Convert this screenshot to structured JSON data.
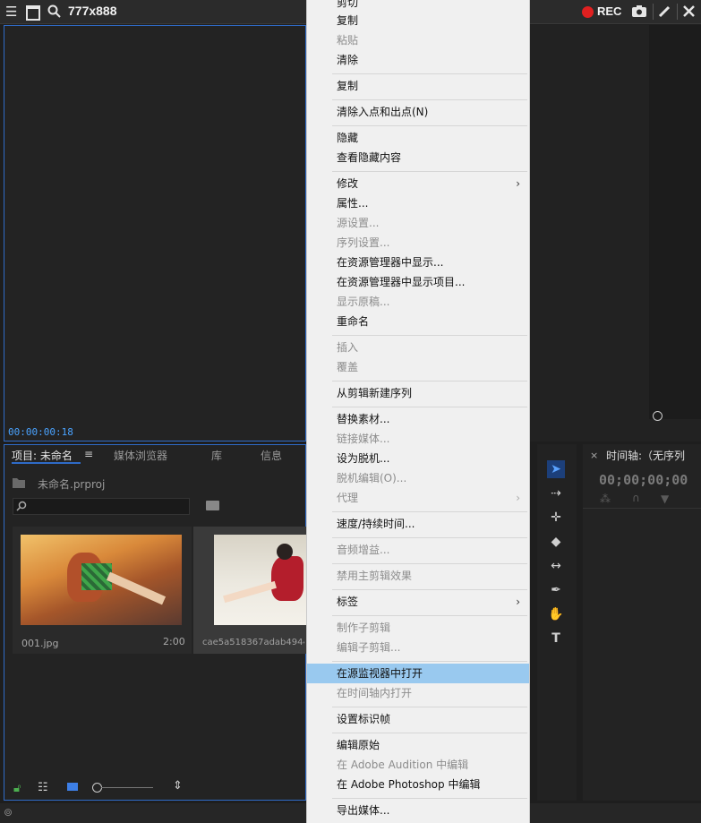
{
  "recorder": {
    "title": "777x888",
    "rec_label": "REC",
    "icons": [
      "menu-icon",
      "window-icon",
      "search-icon",
      "record-icon",
      "camera-icon",
      "pen-icon",
      "close-icon"
    ]
  },
  "source_monitor": {
    "timecode": "00:00:00:18"
  },
  "project_panel": {
    "tabs": [
      "项目: 未命名",
      "媒体浏览器",
      "库",
      "信息"
    ],
    "project_file": "未命名.prproj",
    "items": [
      {
        "name": "001.jpg",
        "duration": "2:00"
      },
      {
        "name": "cae5a518367adab4944e",
        "duration": ""
      }
    ]
  },
  "timeline_panel": {
    "tab_label": "时间轴:（无序列",
    "timecode": "00;00;00;00"
  },
  "context_menu": {
    "items": [
      {
        "label": "剪切",
        "disabled": false
      },
      {
        "label": "复制",
        "disabled": false
      },
      {
        "label": "粘贴",
        "disabled": true
      },
      {
        "label": "清除",
        "disabled": false
      },
      {
        "label": "复制",
        "disabled": false
      },
      {
        "label": "清除入点和出点(N)",
        "disabled": false
      },
      {
        "label": "隐藏",
        "disabled": false
      },
      {
        "label": "查看隐藏内容",
        "disabled": false
      },
      {
        "label": "修改",
        "disabled": false,
        "submenu": true
      },
      {
        "label": "属性...",
        "disabled": false
      },
      {
        "label": "源设置...",
        "disabled": true
      },
      {
        "label": "序列设置...",
        "disabled": true
      },
      {
        "label": "在资源管理器中显示...",
        "disabled": false
      },
      {
        "label": "在资源管理器中显示项目...",
        "disabled": false
      },
      {
        "label": "显示原稿...",
        "disabled": true
      },
      {
        "label": "重命名",
        "disabled": false
      },
      {
        "label": "插入",
        "disabled": true
      },
      {
        "label": "覆盖",
        "disabled": true
      },
      {
        "label": "从剪辑新建序列",
        "disabled": false
      },
      {
        "label": "替换素材...",
        "disabled": false
      },
      {
        "label": "链接媒体...",
        "disabled": true
      },
      {
        "label": "设为脱机...",
        "disabled": false
      },
      {
        "label": "脱机编辑(O)...",
        "disabled": true
      },
      {
        "label": "代理",
        "disabled": true,
        "submenu": true
      },
      {
        "label": "速度/持续时间...",
        "disabled": false
      },
      {
        "label": "音频增益...",
        "disabled": true
      },
      {
        "label": "禁用主剪辑效果",
        "disabled": true
      },
      {
        "label": "标签",
        "disabled": false,
        "submenu": true
      },
      {
        "label": "制作子剪辑",
        "disabled": true
      },
      {
        "label": "编辑子剪辑...",
        "disabled": true
      },
      {
        "label": "在源监视器中打开",
        "disabled": false,
        "highlighted": true
      },
      {
        "label": "在时间轴内打开",
        "disabled": true
      },
      {
        "label": "设置标识帧",
        "disabled": false
      },
      {
        "label": "编辑原始",
        "disabled": false
      },
      {
        "label": "在 Adobe Audition 中编辑",
        "disabled": true
      },
      {
        "label": "在 Adobe Photoshop 中编辑",
        "disabled": false
      },
      {
        "label": "导出媒体...",
        "disabled": false
      }
    ]
  }
}
